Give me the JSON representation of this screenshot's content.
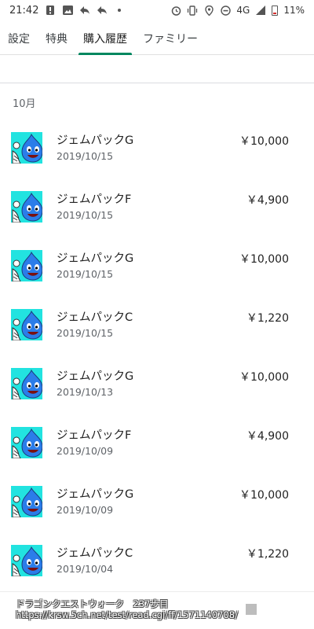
{
  "status_bar": {
    "time": "21:42",
    "network": "4G",
    "battery": "11%"
  },
  "tabs": [
    {
      "label": "設定"
    },
    {
      "label": "特典"
    },
    {
      "label": "購入履歴"
    },
    {
      "label": "ファミリー"
    }
  ],
  "section": {
    "month": "10月"
  },
  "purchases": [
    {
      "name": "ジェムパックG",
      "date": "2019/10/15",
      "price": "￥10,000"
    },
    {
      "name": "ジェムパックF",
      "date": "2019/10/15",
      "price": "￥4,900"
    },
    {
      "name": "ジェムパックG",
      "date": "2019/10/15",
      "price": "￥10,000"
    },
    {
      "name": "ジェムパックC",
      "date": "2019/10/15",
      "price": "￥1,220"
    },
    {
      "name": "ジェムパックG",
      "date": "2019/10/13",
      "price": "￥10,000"
    },
    {
      "name": "ジェムパックF",
      "date": "2019/10/09",
      "price": "￥4,900"
    },
    {
      "name": "ジェムパックG",
      "date": "2019/10/09",
      "price": "￥10,000"
    },
    {
      "name": "ジェムパックC",
      "date": "2019/10/04",
      "price": "￥1,220"
    }
  ],
  "overlay": {
    "line1": "ドラゴンクエストウォーク　237歩目",
    "line2": "https://krsw.5ch.net/test/read.cgi/ff/1571140708/"
  },
  "colors": {
    "accent": "#01875f",
    "thumb_bg": "#22e3e0",
    "slime": "#2b7de9"
  }
}
